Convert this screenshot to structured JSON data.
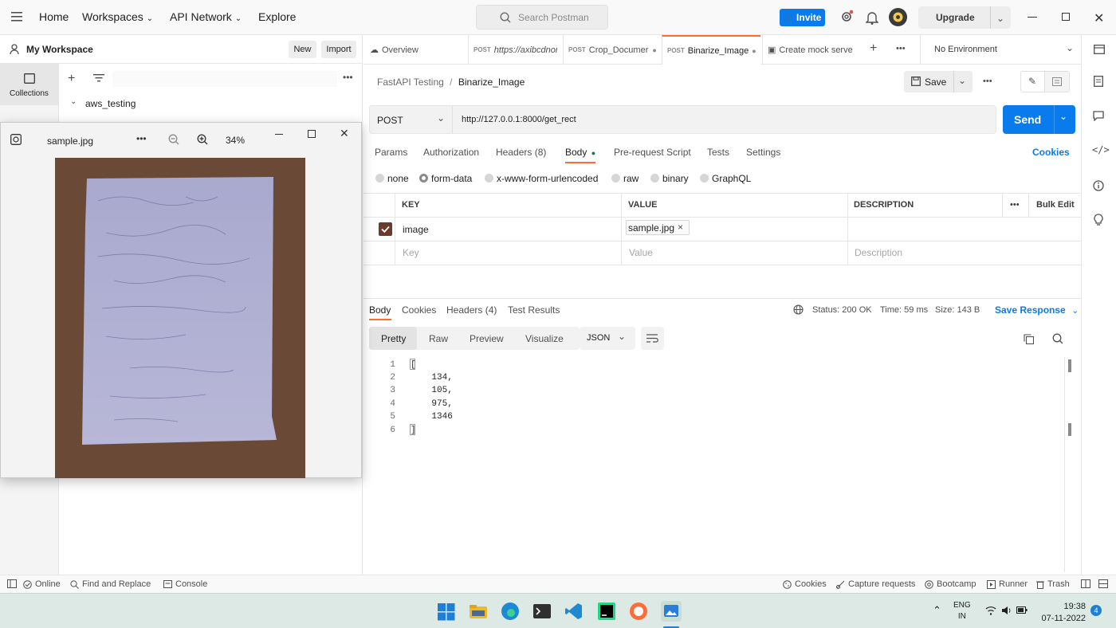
{
  "topbar": {
    "nav": [
      "Home",
      "Workspaces",
      "API Network",
      "Explore"
    ],
    "search_placeholder": "Search Postman",
    "invite_label": "Invite",
    "upgrade_label": "Upgrade"
  },
  "sidebar": {
    "workspace_name": "My Workspace",
    "new_label": "New",
    "import_label": "Import",
    "rail_label": "Collections",
    "collection_name": "aws_testing"
  },
  "viewer": {
    "file_name": "sample.jpg",
    "zoom": "34%"
  },
  "tabs": {
    "overview": "Overview",
    "tab1_method": "POST",
    "tab1_label": "https://axibcdnor",
    "tab2_method": "POST",
    "tab2_label": "Crop_Documer",
    "tab3_method": "POST",
    "tab3_label": "Binarize_Image",
    "tab4_label": "Create mock serve",
    "environment": "No Environment"
  },
  "request": {
    "breadcrumb_parent": "FastAPI Testing",
    "breadcrumb_sep": "/",
    "breadcrumb_current": "Binarize_Image",
    "save_label": "Save",
    "method": "POST",
    "url": "http://127.0.0.1:8000/get_rect",
    "send_label": "Send",
    "subtabs": [
      "Params",
      "Authorization",
      "Headers (8)",
      "Body",
      "Pre-request Script",
      "Tests",
      "Settings"
    ],
    "cookies_label": "Cookies",
    "body_modes": [
      "none",
      "form-data",
      "x-www-form-urlencoded",
      "raw",
      "binary",
      "GraphQL"
    ],
    "selected_body_mode": "form-data",
    "table": {
      "headers": [
        "KEY",
        "VALUE",
        "DESCRIPTION"
      ],
      "bulk_edit": "Bulk Edit",
      "row_key": "image",
      "row_value": "sample.jpg",
      "placeholder_key": "Key",
      "placeholder_value": "Value",
      "placeholder_desc": "Description"
    }
  },
  "response": {
    "tabs": [
      "Body",
      "Cookies",
      "Headers (4)",
      "Test Results"
    ],
    "status": "Status: 200 OK",
    "time": "Time: 59 ms",
    "size": "Size: 143 B",
    "save_response": "Save Response",
    "view_tabs": [
      "Pretty",
      "Raw",
      "Preview",
      "Visualize"
    ],
    "format": "JSON",
    "line_numbers": [
      "1",
      "2",
      "3",
      "4",
      "5",
      "6"
    ],
    "lines": [
      "[",
      "    134,",
      "    105,",
      "    975,",
      "    1346",
      "]"
    ]
  },
  "statusbar": {
    "online": "Online",
    "find_replace": "Find and Replace",
    "console": "Console",
    "cookies": "Cookies",
    "capture": "Capture requests",
    "bootcamp": "Bootcamp",
    "runner": "Runner",
    "trash": "Trash"
  },
  "taskbar": {
    "lang1": "ENG",
    "lang2": "IN",
    "time": "19:38",
    "date": "07-11-2022",
    "notifications": "4"
  }
}
